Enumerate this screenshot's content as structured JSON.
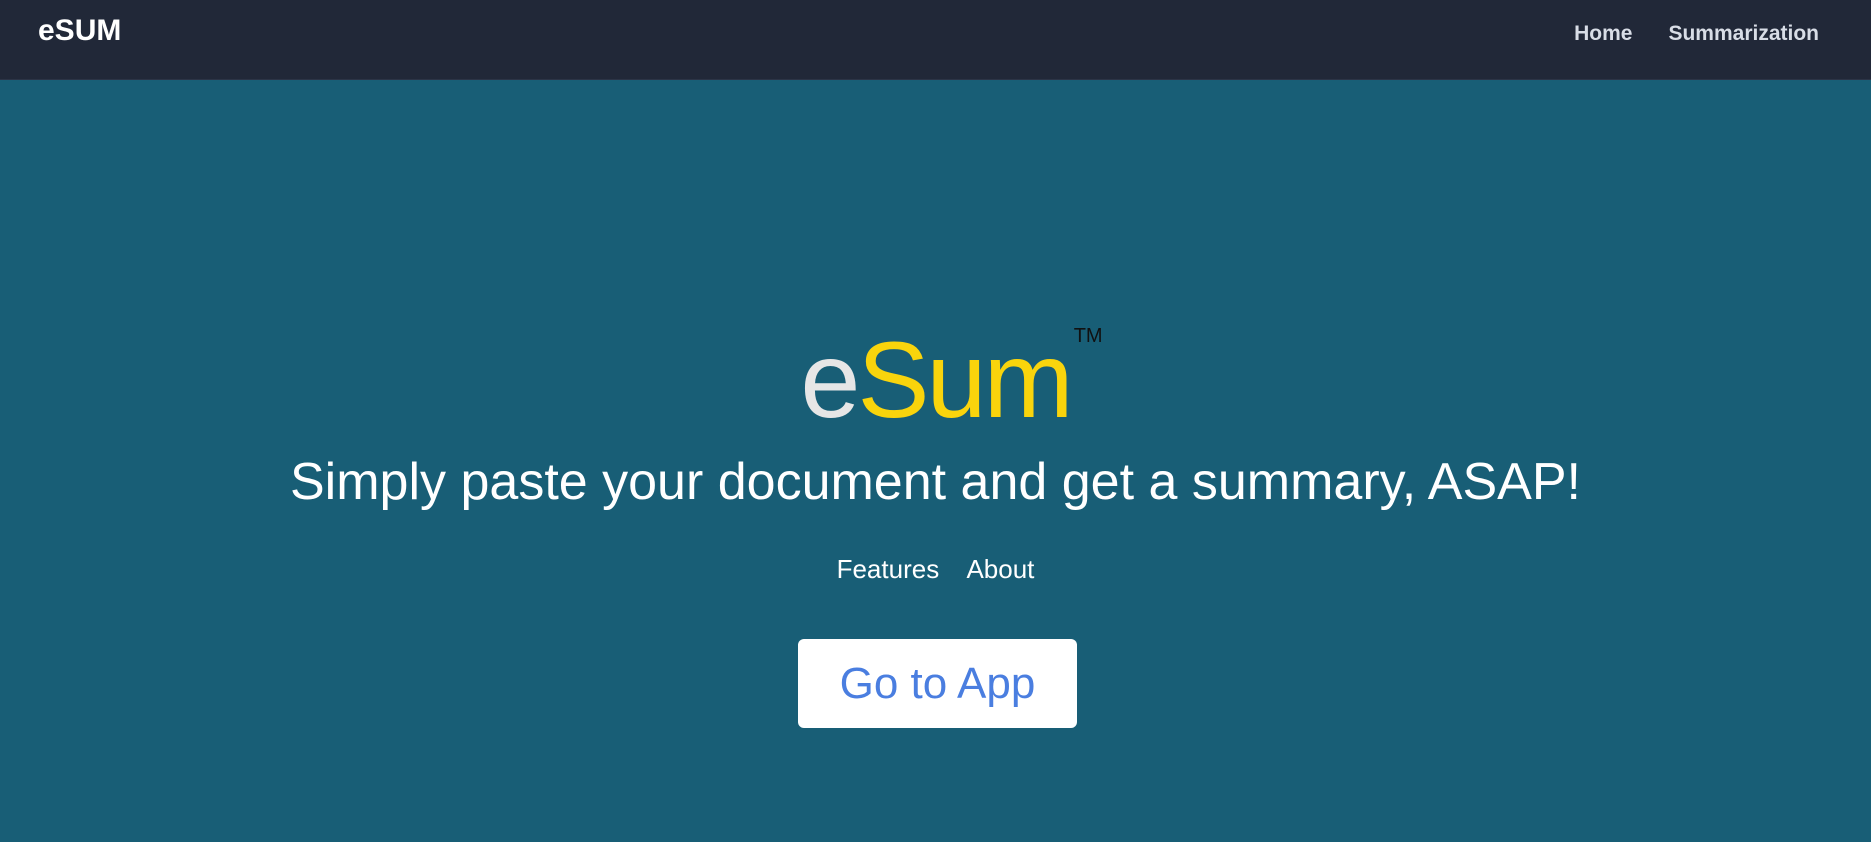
{
  "navbar": {
    "brand": "eSUM",
    "links": [
      "Home",
      "Summarization"
    ]
  },
  "hero": {
    "logo_e": "e",
    "logo_sum": "Sum",
    "trademark": "TM",
    "tagline": "Simply paste your document and get a summary, ASAP!",
    "sub_links": [
      "Features",
      "About"
    ],
    "cta_label": "Go to App"
  },
  "colors": {
    "navbar_bg": "#212838",
    "hero_bg": "#185e76",
    "logo_e": "#e6e6e6",
    "logo_sum": "#f9d40c",
    "cta_text": "#4a7ee0"
  }
}
